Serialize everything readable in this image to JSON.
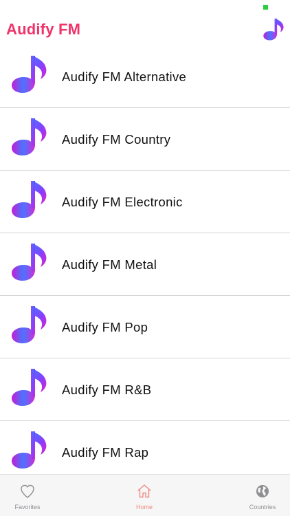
{
  "header": {
    "title": "Audify FM",
    "logo_icon": "music-note-logo",
    "accent_color": "#f0346a"
  },
  "stations": [
    {
      "label": "Audify FM Alternative",
      "icon": "music-note-icon"
    },
    {
      "label": "Audify FM Country",
      "icon": "music-note-icon"
    },
    {
      "label": "Audify FM Electronic",
      "icon": "music-note-icon"
    },
    {
      "label": "Audify FM Metal",
      "icon": "music-note-icon"
    },
    {
      "label": "Audify FM Pop",
      "icon": "music-note-icon"
    },
    {
      "label": "Audify FM R&B",
      "icon": "music-note-icon"
    },
    {
      "label": "Audify FM Rap",
      "icon": "music-note-icon"
    }
  ],
  "tabbar": {
    "tabs": [
      {
        "label": "Favorites",
        "icon": "heart-icon",
        "active": false
      },
      {
        "label": "Home",
        "icon": "home-icon",
        "active": true
      },
      {
        "label": "Countries",
        "icon": "globe-icon",
        "active": false
      }
    ],
    "active_color": "#f08a7e",
    "inactive_color": "#8e8e93"
  }
}
